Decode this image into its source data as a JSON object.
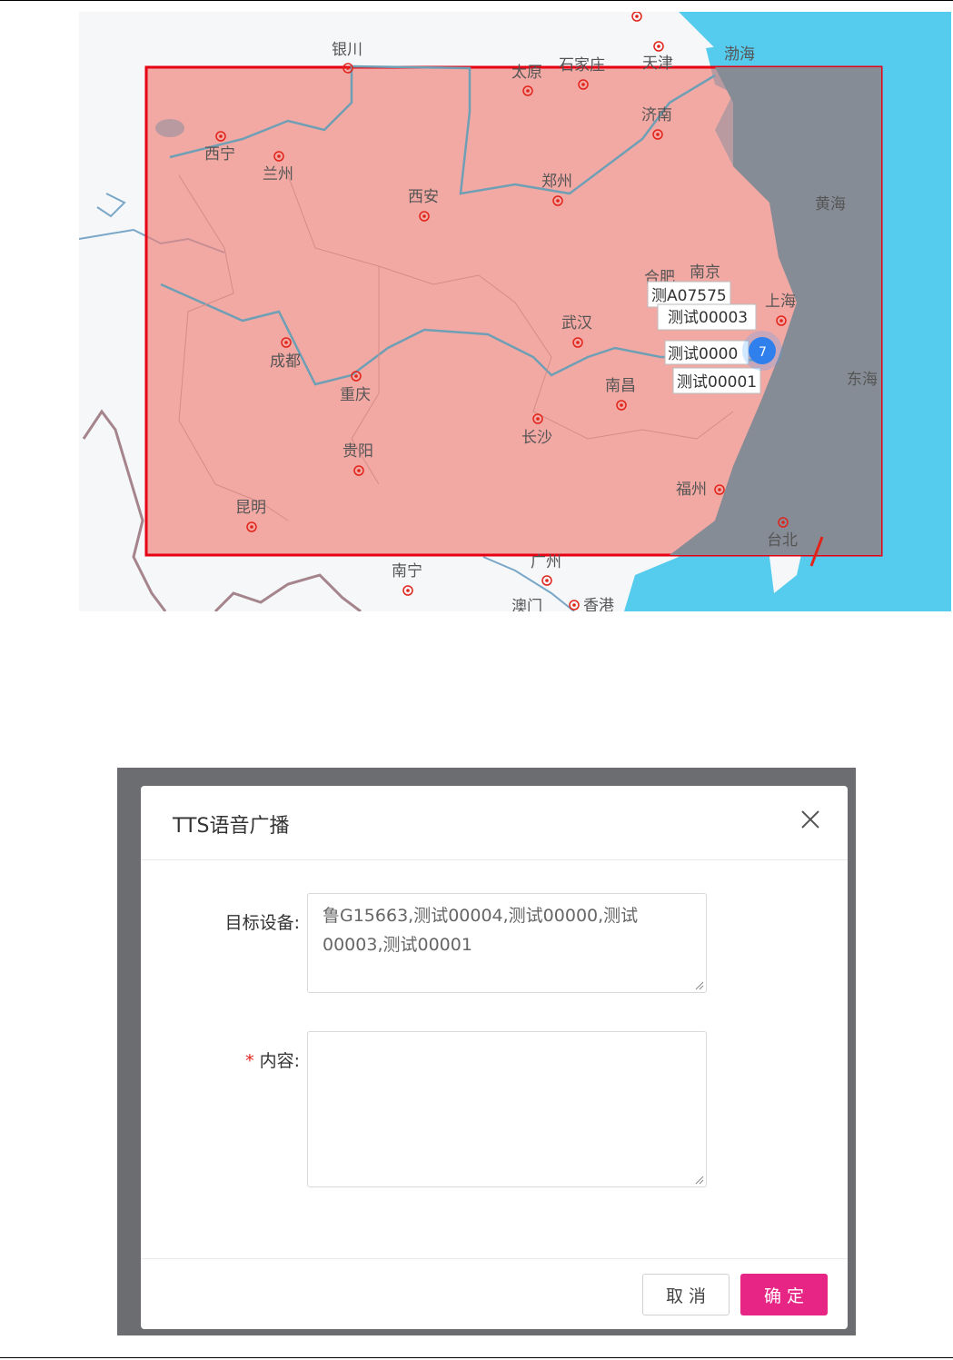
{
  "map": {
    "cities": [
      "银川",
      "太原",
      "石家庄",
      "天津",
      "渤海",
      "西宁",
      "兰州",
      "济南",
      "西安",
      "郑州",
      "黄海",
      "南京",
      "上海",
      "武汉",
      "成都",
      "重庆",
      "南昌",
      "长沙",
      "东海",
      "贵阳",
      "福州",
      "昆明",
      "台北",
      "南宁",
      "广州",
      "澳门",
      "香港",
      "合肥"
    ],
    "device_tags": [
      "测A07575",
      "测试00003",
      "测试0000",
      "测试00001"
    ],
    "cluster_count": "7",
    "selection_color": "#e60012",
    "selection_fill": "#f4a09c",
    "sea_color": "#55ccee",
    "land_color": "#f5f7f9"
  },
  "dialog": {
    "title": "TTS语音广播",
    "target_label": "目标设备:",
    "target_value": "鲁G15663,测试00004,测试00000,测试00003,测试00001",
    "required_mark": "*",
    "content_label": "内容:",
    "content_value": "",
    "cancel_label": "取 消",
    "ok_label": "确 定",
    "ok_color": "#e62585"
  }
}
